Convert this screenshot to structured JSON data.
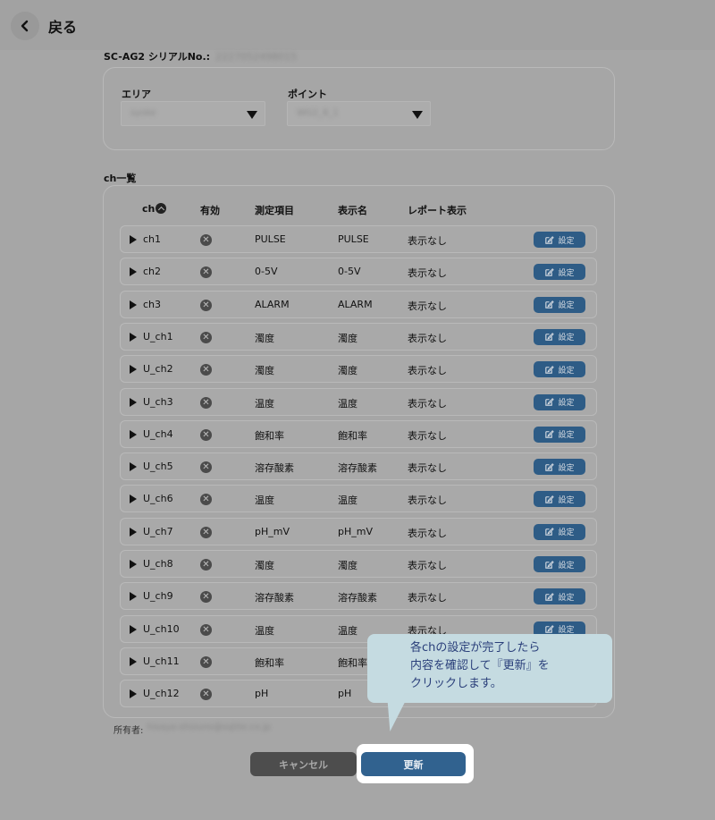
{
  "header": {
    "back_label": "戻る"
  },
  "serial": {
    "label": "SC-AG2 シリアルNo.:",
    "value": "2227052498015"
  },
  "filters": {
    "area_label": "エリア",
    "area_value": "syoke",
    "point_label": "ポイント",
    "point_value": "WG2_8_1"
  },
  "list": {
    "title": "ch一覧",
    "columns": {
      "ch": "ch",
      "enabled": "有効",
      "item": "測定項目",
      "display": "表示名",
      "report": "レポート表示"
    },
    "settings_label": "設定",
    "rows": [
      {
        "ch": "ch1",
        "item": "PULSE",
        "display": "PULSE",
        "report": "表示なし"
      },
      {
        "ch": "ch2",
        "item": "0-5V",
        "display": "0-5V",
        "report": "表示なし"
      },
      {
        "ch": "ch3",
        "item": "ALARM",
        "display": "ALARM",
        "report": "表示なし"
      },
      {
        "ch": "U_ch1",
        "item": "濁度",
        "display": "濁度",
        "report": "表示なし"
      },
      {
        "ch": "U_ch2",
        "item": "濁度",
        "display": "濁度",
        "report": "表示なし"
      },
      {
        "ch": "U_ch3",
        "item": "温度",
        "display": "温度",
        "report": "表示なし"
      },
      {
        "ch": "U_ch4",
        "item": "飽和率",
        "display": "飽和率",
        "report": "表示なし"
      },
      {
        "ch": "U_ch5",
        "item": "溶存酸素",
        "display": "溶存酸素",
        "report": "表示なし"
      },
      {
        "ch": "U_ch6",
        "item": "温度",
        "display": "温度",
        "report": "表示なし"
      },
      {
        "ch": "U_ch7",
        "item": "pH_mV",
        "display": "pH_mV",
        "report": "表示なし"
      },
      {
        "ch": "U_ch8",
        "item": "濁度",
        "display": "濁度",
        "report": "表示なし"
      },
      {
        "ch": "U_ch9",
        "item": "溶存酸素",
        "display": "溶存酸素",
        "report": "表示なし"
      },
      {
        "ch": "U_ch10",
        "item": "温度",
        "display": "温度",
        "report": "表示なし"
      },
      {
        "ch": "U_ch11",
        "item": "飽和率",
        "display": "飽和率",
        "report": ""
      },
      {
        "ch": "U_ch12",
        "item": "pH",
        "display": "pH",
        "report": ""
      }
    ]
  },
  "owner": {
    "label": "所有者:",
    "value": "hisaya-shizuno@sqlite.co.jp"
  },
  "actions": {
    "cancel_label": "キャンセル",
    "update_label": "更新"
  },
  "callout": {
    "line1": "各chの設定が完了したら",
    "line2": "内容を確認して『更新』を",
    "line3": "クリックします。"
  }
}
